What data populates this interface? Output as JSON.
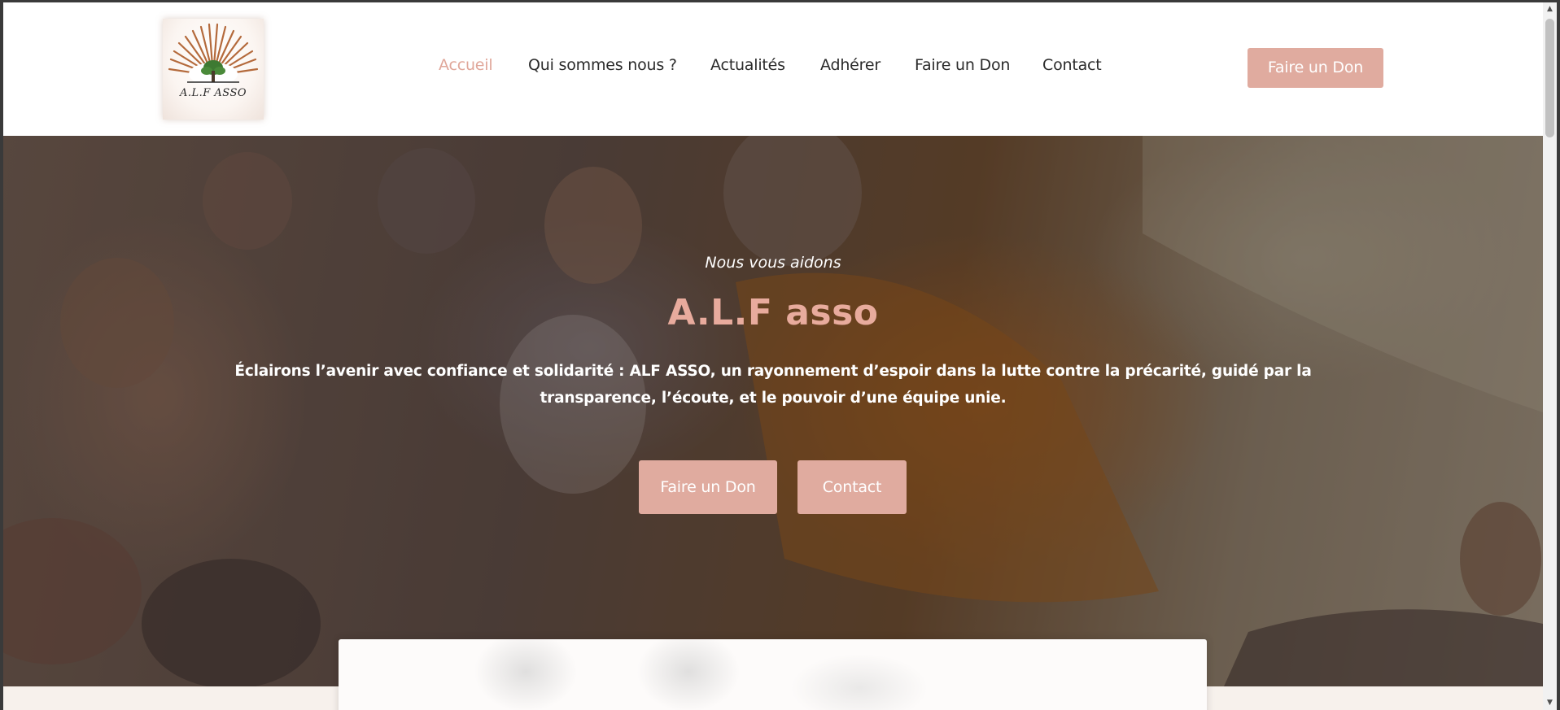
{
  "logo": {
    "text": "A.L.F ASSO"
  },
  "nav": {
    "items": [
      {
        "label": "Accueil",
        "active": true
      },
      {
        "label": "Qui sommes nous ?",
        "active": false
      },
      {
        "label": "Actualités",
        "active": false
      },
      {
        "label": "Adhérer",
        "active": false
      },
      {
        "label": "Faire un Don",
        "active": false
      },
      {
        "label": "Contact",
        "active": false
      }
    ],
    "cta_label": "Faire un Don"
  },
  "hero": {
    "eyebrow": "Nous vous aidons",
    "title": "A.L.F asso",
    "description": "Éclairons l’avenir avec confiance et solidarité : ALF ASSO, un rayonnement d’espoir dans la lutte contre la précarité, guidé par la transparence, l’écoute, et le pouvoir d’une équipe unie.",
    "buttons": {
      "donate": "Faire un Don",
      "contact": "Contact"
    }
  },
  "colors": {
    "accent": "#e0ab9f",
    "title": "#e8ab9d",
    "nav_text": "#2b2b2b",
    "header_bg": "#ffffff"
  },
  "icons": {
    "scroll_up": "triangle-up-icon",
    "scroll_down": "triangle-down-icon"
  }
}
